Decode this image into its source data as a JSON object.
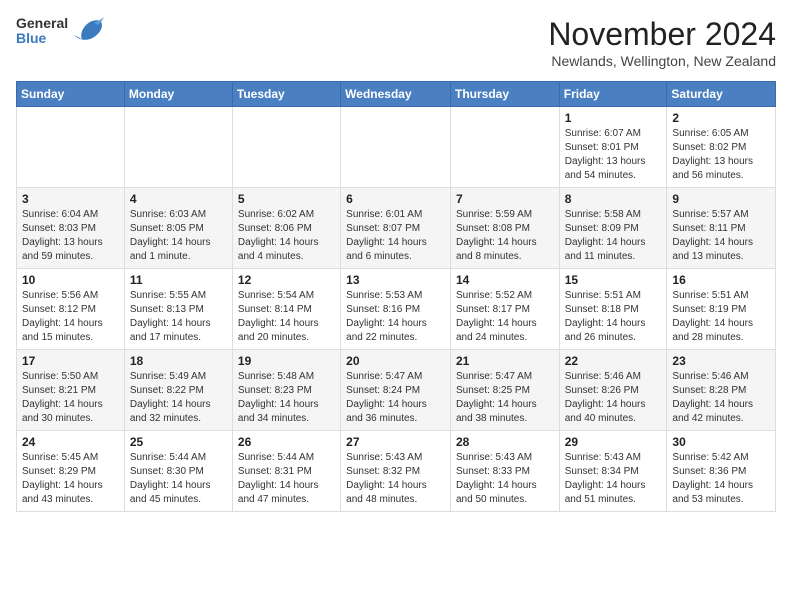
{
  "header": {
    "logo_general": "General",
    "logo_blue": "Blue",
    "month_title": "November 2024",
    "location": "Newlands, Wellington, New Zealand"
  },
  "days_of_week": [
    "Sunday",
    "Monday",
    "Tuesday",
    "Wednesday",
    "Thursday",
    "Friday",
    "Saturday"
  ],
  "weeks": [
    [
      {
        "day": "",
        "info": ""
      },
      {
        "day": "",
        "info": ""
      },
      {
        "day": "",
        "info": ""
      },
      {
        "day": "",
        "info": ""
      },
      {
        "day": "",
        "info": ""
      },
      {
        "day": "1",
        "info": "Sunrise: 6:07 AM\nSunset: 8:01 PM\nDaylight: 13 hours and 54 minutes."
      },
      {
        "day": "2",
        "info": "Sunrise: 6:05 AM\nSunset: 8:02 PM\nDaylight: 13 hours and 56 minutes."
      }
    ],
    [
      {
        "day": "3",
        "info": "Sunrise: 6:04 AM\nSunset: 8:03 PM\nDaylight: 13 hours and 59 minutes."
      },
      {
        "day": "4",
        "info": "Sunrise: 6:03 AM\nSunset: 8:05 PM\nDaylight: 14 hours and 1 minute."
      },
      {
        "day": "5",
        "info": "Sunrise: 6:02 AM\nSunset: 8:06 PM\nDaylight: 14 hours and 4 minutes."
      },
      {
        "day": "6",
        "info": "Sunrise: 6:01 AM\nSunset: 8:07 PM\nDaylight: 14 hours and 6 minutes."
      },
      {
        "day": "7",
        "info": "Sunrise: 5:59 AM\nSunset: 8:08 PM\nDaylight: 14 hours and 8 minutes."
      },
      {
        "day": "8",
        "info": "Sunrise: 5:58 AM\nSunset: 8:09 PM\nDaylight: 14 hours and 11 minutes."
      },
      {
        "day": "9",
        "info": "Sunrise: 5:57 AM\nSunset: 8:11 PM\nDaylight: 14 hours and 13 minutes."
      }
    ],
    [
      {
        "day": "10",
        "info": "Sunrise: 5:56 AM\nSunset: 8:12 PM\nDaylight: 14 hours and 15 minutes."
      },
      {
        "day": "11",
        "info": "Sunrise: 5:55 AM\nSunset: 8:13 PM\nDaylight: 14 hours and 17 minutes."
      },
      {
        "day": "12",
        "info": "Sunrise: 5:54 AM\nSunset: 8:14 PM\nDaylight: 14 hours and 20 minutes."
      },
      {
        "day": "13",
        "info": "Sunrise: 5:53 AM\nSunset: 8:16 PM\nDaylight: 14 hours and 22 minutes."
      },
      {
        "day": "14",
        "info": "Sunrise: 5:52 AM\nSunset: 8:17 PM\nDaylight: 14 hours and 24 minutes."
      },
      {
        "day": "15",
        "info": "Sunrise: 5:51 AM\nSunset: 8:18 PM\nDaylight: 14 hours and 26 minutes."
      },
      {
        "day": "16",
        "info": "Sunrise: 5:51 AM\nSunset: 8:19 PM\nDaylight: 14 hours and 28 minutes."
      }
    ],
    [
      {
        "day": "17",
        "info": "Sunrise: 5:50 AM\nSunset: 8:21 PM\nDaylight: 14 hours and 30 minutes."
      },
      {
        "day": "18",
        "info": "Sunrise: 5:49 AM\nSunset: 8:22 PM\nDaylight: 14 hours and 32 minutes."
      },
      {
        "day": "19",
        "info": "Sunrise: 5:48 AM\nSunset: 8:23 PM\nDaylight: 14 hours and 34 minutes."
      },
      {
        "day": "20",
        "info": "Sunrise: 5:47 AM\nSunset: 8:24 PM\nDaylight: 14 hours and 36 minutes."
      },
      {
        "day": "21",
        "info": "Sunrise: 5:47 AM\nSunset: 8:25 PM\nDaylight: 14 hours and 38 minutes."
      },
      {
        "day": "22",
        "info": "Sunrise: 5:46 AM\nSunset: 8:26 PM\nDaylight: 14 hours and 40 minutes."
      },
      {
        "day": "23",
        "info": "Sunrise: 5:46 AM\nSunset: 8:28 PM\nDaylight: 14 hours and 42 minutes."
      }
    ],
    [
      {
        "day": "24",
        "info": "Sunrise: 5:45 AM\nSunset: 8:29 PM\nDaylight: 14 hours and 43 minutes."
      },
      {
        "day": "25",
        "info": "Sunrise: 5:44 AM\nSunset: 8:30 PM\nDaylight: 14 hours and 45 minutes."
      },
      {
        "day": "26",
        "info": "Sunrise: 5:44 AM\nSunset: 8:31 PM\nDaylight: 14 hours and 47 minutes."
      },
      {
        "day": "27",
        "info": "Sunrise: 5:43 AM\nSunset: 8:32 PM\nDaylight: 14 hours and 48 minutes."
      },
      {
        "day": "28",
        "info": "Sunrise: 5:43 AM\nSunset: 8:33 PM\nDaylight: 14 hours and 50 minutes."
      },
      {
        "day": "29",
        "info": "Sunrise: 5:43 AM\nSunset: 8:34 PM\nDaylight: 14 hours and 51 minutes."
      },
      {
        "day": "30",
        "info": "Sunrise: 5:42 AM\nSunset: 8:36 PM\nDaylight: 14 hours and 53 minutes."
      }
    ]
  ]
}
